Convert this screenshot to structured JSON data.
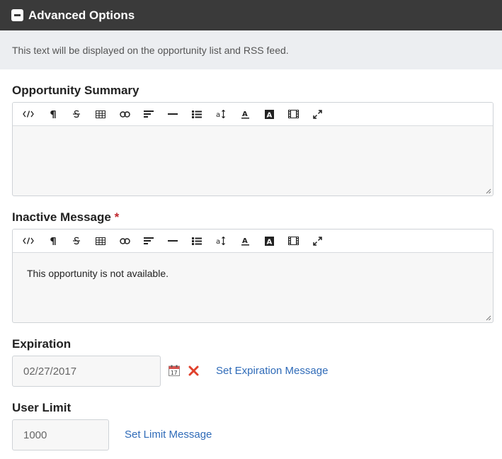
{
  "header": {
    "title": "Advanced Options"
  },
  "info": {
    "text": "This text will be displayed on the opportunity list and RSS feed."
  },
  "summary": {
    "label": "Opportunity Summary",
    "content": ""
  },
  "inactive": {
    "label": "Inactive Message",
    "required_mark": "*",
    "content": "This opportunity is not available."
  },
  "expiration": {
    "label": "Expiration",
    "date_value": "02/27/2017",
    "set_message_link": "Set Expiration Message"
  },
  "user_limit": {
    "label": "User Limit",
    "value": "1000",
    "set_message_link": "Set Limit Message"
  },
  "toolbar_icons": [
    "code-view-icon",
    "paragraph-icon",
    "strikethrough-icon",
    "table-icon",
    "link-icon",
    "align-left-icon",
    "horizontal-rule-icon",
    "list-icon",
    "font-size-icon",
    "font-color-icon",
    "background-color-icon",
    "video-icon",
    "fullscreen-icon"
  ],
  "colors": {
    "header_bg": "#3a3a3a",
    "info_bg": "#eceef1",
    "link": "#2f6bb8",
    "required": "#c0272d",
    "clear": "#e0412c"
  }
}
